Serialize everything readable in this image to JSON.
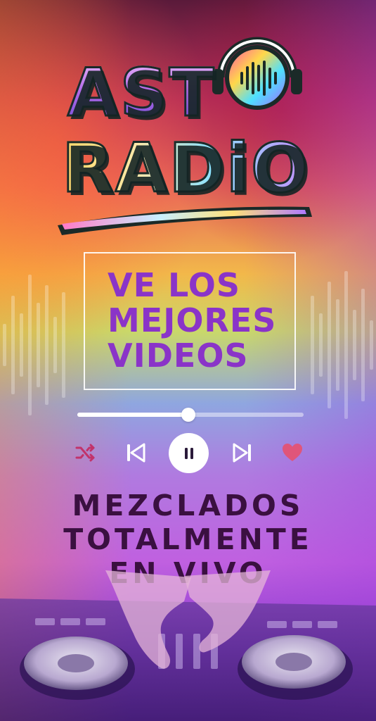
{
  "logo": {
    "line1": "AST",
    "line2": "RADiO",
    "icon": "headphones-icon"
  },
  "promo": {
    "line1": "VE LOS",
    "line2": "MEJORES",
    "line3": "VIDEOS",
    "text_color": "#8a34c8"
  },
  "player": {
    "progress": 0.49,
    "icons": {
      "shuffle": "shuffle-icon",
      "previous": "skip-previous-icon",
      "pause": "pause-icon",
      "next": "skip-next-icon",
      "like": "heart-icon"
    },
    "accent_heart": "#e0557a",
    "accent_shuffle": "#c2336a"
  },
  "tagline": {
    "line1": "MEZCLADOS",
    "line2": "TOTALMENTE",
    "line3": "EN VIVO",
    "text_color": "#3a1040"
  }
}
